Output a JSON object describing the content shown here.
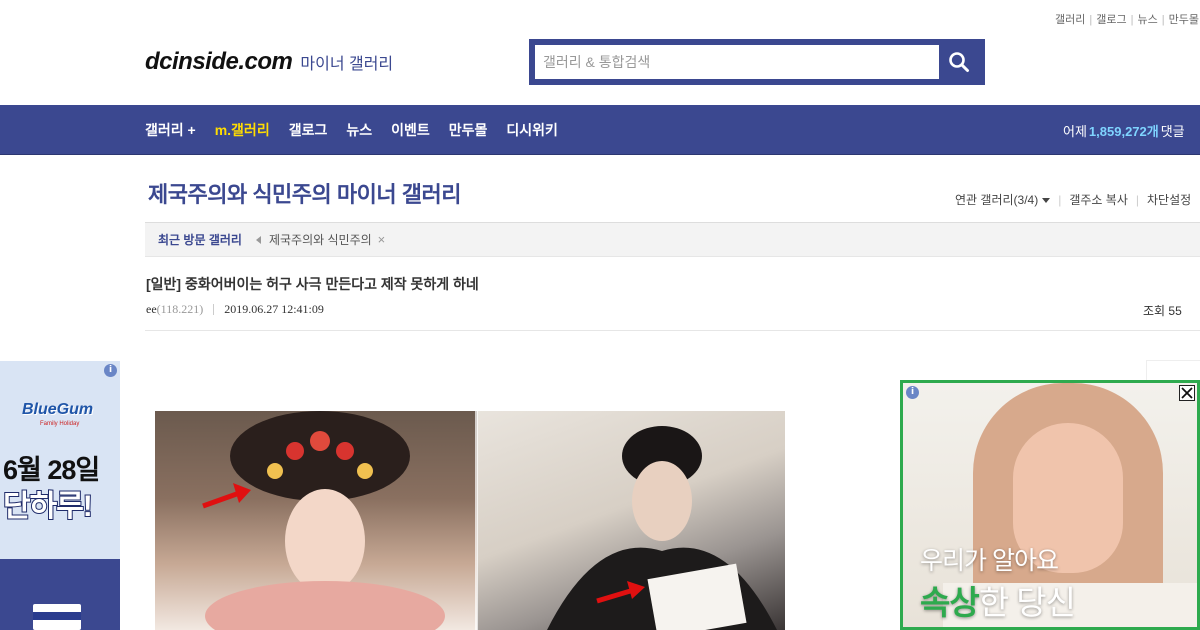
{
  "top_links": [
    "갤러리",
    "갤로그",
    "뉴스",
    "만두몰"
  ],
  "header": {
    "logo": "dcinside.com",
    "logo_sub": "마이너 갤러리",
    "search_placeholder": "갤러리 & 통합검색"
  },
  "nav": {
    "items": [
      {
        "label": "갤러리 +"
      },
      {
        "label": "m.갤러리"
      },
      {
        "label": "갤로그"
      },
      {
        "label": "뉴스"
      },
      {
        "label": "이벤트"
      },
      {
        "label": "만두몰"
      },
      {
        "label": "디시위키"
      }
    ],
    "stats_prefix": "어제",
    "stats_value": "1,859,272개",
    "stats_suffix": "댓글"
  },
  "gallery": {
    "title": "제국주의와 식민주의 마이너 갤러리",
    "related": "연관 갤러리(3/4)",
    "copy_address": "갤주소 복사",
    "block_settings": "차단설정"
  },
  "recent": {
    "label": "최근 방문 갤러리",
    "items": [
      "제국주의와 식민주의"
    ],
    "close": "×"
  },
  "post": {
    "title": "[일반] 중화어버이는 허구 사극 만든다고 제작 못하게 하네",
    "author": "ee",
    "ip": "(118.221)",
    "date": "2019.06.27 12:41:09",
    "views": "조회 55"
  },
  "ads": {
    "info": "i",
    "left": {
      "brand": "BlueGum",
      "brand_sub": "Family Holiday",
      "date": "6월 28일",
      "oneday": "단하루!"
    },
    "right": {
      "line1": "우리가 알아요",
      "line2_highlight": "속상",
      "line2_rest": "한 당신",
      "close": "×"
    }
  },
  "colors": {
    "brand": "#3b4890",
    "nav_active": "#ffdd00",
    "stats_number": "#7fd4ff",
    "ad_green": "#2eaa4e"
  },
  "icons": {
    "search": "search-icon",
    "close": "close-icon",
    "info": "info-icon",
    "dropdown": "caret-down-icon",
    "recent_arrow": "caret-left-icon"
  }
}
